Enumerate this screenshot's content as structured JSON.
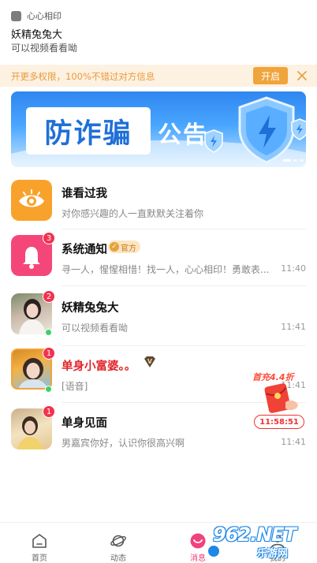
{
  "notification": {
    "app_name": "心心相印",
    "title": "妖精兔兔大",
    "body": "可以视频看看呦"
  },
  "vip_bar": {
    "text": "开更多权限，100%不错过对方信息",
    "open_label": "开启",
    "close_icon": "close-icon"
  },
  "banner": {
    "big_text": "防诈骗",
    "small_text": "公告",
    "icon": "shield-lightning-icon"
  },
  "conversations": [
    {
      "name": "谁看过我",
      "message": "对你感兴趣的人一直默默关注着你",
      "time": "",
      "badge": "",
      "icon": "eye-icon",
      "color": "#f9a22b"
    },
    {
      "name": "系统通知",
      "official_label": "官方",
      "message": "寻一人，惺惺相惜！找一人，心心相印！勇敢表...",
      "time": "11:40",
      "badge": "3",
      "icon": "bell-icon",
      "color": "#f5467a"
    },
    {
      "name": "妖精兔兔大",
      "message": "可以视频看看呦",
      "time": "11:41",
      "badge": "2",
      "online": true
    },
    {
      "name": "单身小富婆。。",
      "message": "[语音]",
      "time": "11:41",
      "badge": "1",
      "vip": true,
      "name_color": "#e0262a"
    },
    {
      "name": "单身见面",
      "message": "男嘉宾你好，认识你很高兴啊",
      "time": "11:41",
      "badge": "1"
    }
  ],
  "promo": {
    "title": "首充4.4折",
    "countdown": "11:58:51",
    "icon": "red-packet-icon"
  },
  "tabs": [
    {
      "label": "首页",
      "icon": "home-icon",
      "active": false
    },
    {
      "label": "动态",
      "icon": "planet-icon",
      "active": false
    },
    {
      "label": "消息",
      "icon": "message-icon",
      "active": true
    },
    {
      "label": "我的",
      "icon": "user-icon",
      "active": false
    }
  ],
  "watermark": {
    "main": "962.NET",
    "sub": "乐游网"
  }
}
